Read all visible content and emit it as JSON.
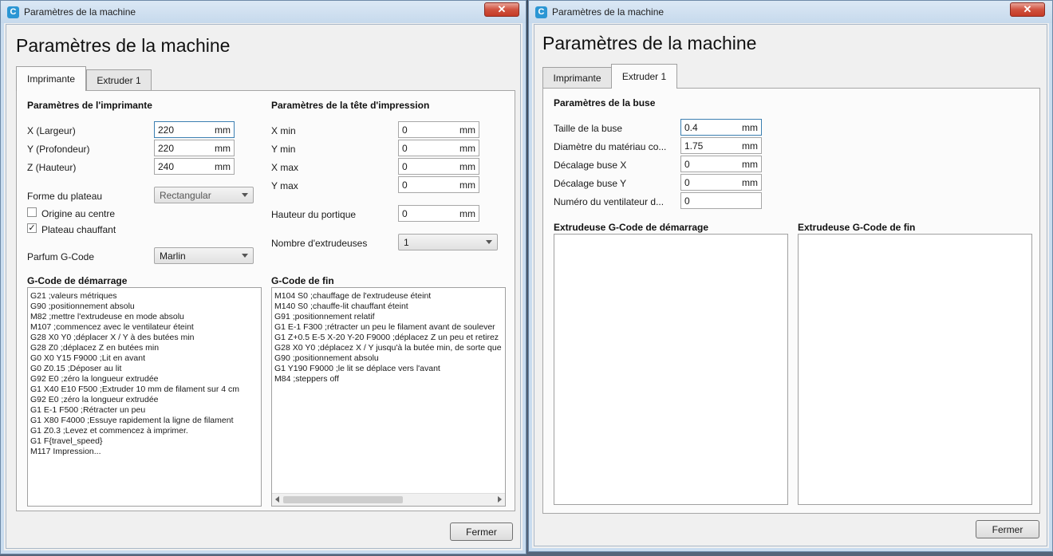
{
  "left_window": {
    "title": "Paramètres de la machine",
    "heading": "Paramètres de la machine",
    "close_glyph": "✕",
    "tabs": [
      {
        "label": "Imprimante"
      },
      {
        "label": "Extruder 1"
      }
    ],
    "printer_section": {
      "title": "Paramètres de l'imprimante",
      "fields": [
        {
          "label": "X (Largeur)",
          "value": "220",
          "unit": "mm"
        },
        {
          "label": "Y (Profondeur)",
          "value": "220",
          "unit": "mm"
        },
        {
          "label": "Z (Hauteur)",
          "value": "240",
          "unit": "mm"
        }
      ],
      "bed_shape": {
        "label": "Forme du plateau",
        "value": "Rectangular"
      },
      "origin_center": {
        "label": "Origine au centre",
        "checked": false
      },
      "heated_bed": {
        "label": "Plateau chauffant",
        "checked": true,
        "glyph": "✓"
      },
      "gcode_flavor": {
        "label": "Parfum G-Code",
        "value": "Marlin"
      }
    },
    "head_section": {
      "title": "Paramètres de la tête d'impression",
      "fields": [
        {
          "label": "X min",
          "value": "0",
          "unit": "mm"
        },
        {
          "label": "Y min",
          "value": "0",
          "unit": "mm"
        },
        {
          "label": "X max",
          "value": "0",
          "unit": "mm"
        },
        {
          "label": "Y max",
          "value": "0",
          "unit": "mm"
        }
      ],
      "gantry_height": {
        "label": "Hauteur du portique",
        "value": "0",
        "unit": "mm"
      },
      "extruder_count": {
        "label": "Nombre d'extrudeuses",
        "value": "1"
      }
    },
    "start_gcode": {
      "title": "G-Code de démarrage",
      "lines": [
        "G21 ;valeurs métriques",
        "G90 ;positionnement absolu",
        "M82 ;mettre l'extrudeuse en mode absolu",
        "M107 ;commencez avec le ventilateur éteint",
        "G28 X0 Y0 ;déplacer X / Y à des butées min",
        "G28 Z0 ;déplacez Z en butées min",
        "G0 X0 Y15 F9000 ;Lit en avant",
        "G0 Z0.15 ;Déposer au lit",
        "G92 E0 ;zéro la longueur extrudée",
        "G1 X40 E10 F500 ;Extruder 10 mm de filament sur 4 cm",
        "G92 E0 ;zéro la longueur extrudée",
        "G1 E-1 F500 ;Rétracter un peu",
        "G1 X80 F4000 ;Essuye rapidement la ligne de filament",
        "G1 Z0.3 ;Levez et commencez à imprimer.",
        "G1 F{travel_speed}",
        "M117 Impression..."
      ]
    },
    "end_gcode": {
      "title": "G-Code de fin",
      "lines": [
        "M104 S0 ;chauffage de l'extrudeuse éteint",
        "M140 S0 ;chauffe-lit chauffant éteint",
        "G91 ;positionnement relatif",
        "G1 E-1 F300 ;rétracter un peu le filament avant de soulever",
        "G1 Z+0.5 E-5 X-20 Y-20 F9000 ;déplacez Z un peu et retirez",
        "G28 X0 Y0 ;déplacez X / Y jusqu'à la butée min, de sorte que",
        "G90 ;positionnement absolu",
        "G1 Y190 F9000 ;le lit se déplace vers l'avant",
        "M84 ;steppers off"
      ]
    },
    "close_button": "Fermer"
  },
  "right_window": {
    "title": "Paramètres de la machine",
    "heading": "Paramètres de la machine",
    "close_glyph": "✕",
    "tabs": [
      {
        "label": "Imprimante"
      },
      {
        "label": "Extruder 1"
      }
    ],
    "nozzle_section": {
      "title": "Paramètres de la buse",
      "fields": [
        {
          "label": "Taille de la buse",
          "value": "0.4",
          "unit": "mm"
        },
        {
          "label": "Diamètre du matériau co...",
          "value": "1.75",
          "unit": "mm"
        },
        {
          "label": "Décalage buse X",
          "value": "0",
          "unit": "mm"
        },
        {
          "label": "Décalage buse Y",
          "value": "0",
          "unit": "mm"
        },
        {
          "label": "Numéro du ventilateur d...",
          "value": "0",
          "unit": ""
        }
      ]
    },
    "extruder_start_gcode": {
      "title": "Extrudeuse G-Code de démarrage"
    },
    "extruder_end_gcode": {
      "title": "Extrudeuse G-Code de fin"
    },
    "close_button": "Fermer"
  }
}
